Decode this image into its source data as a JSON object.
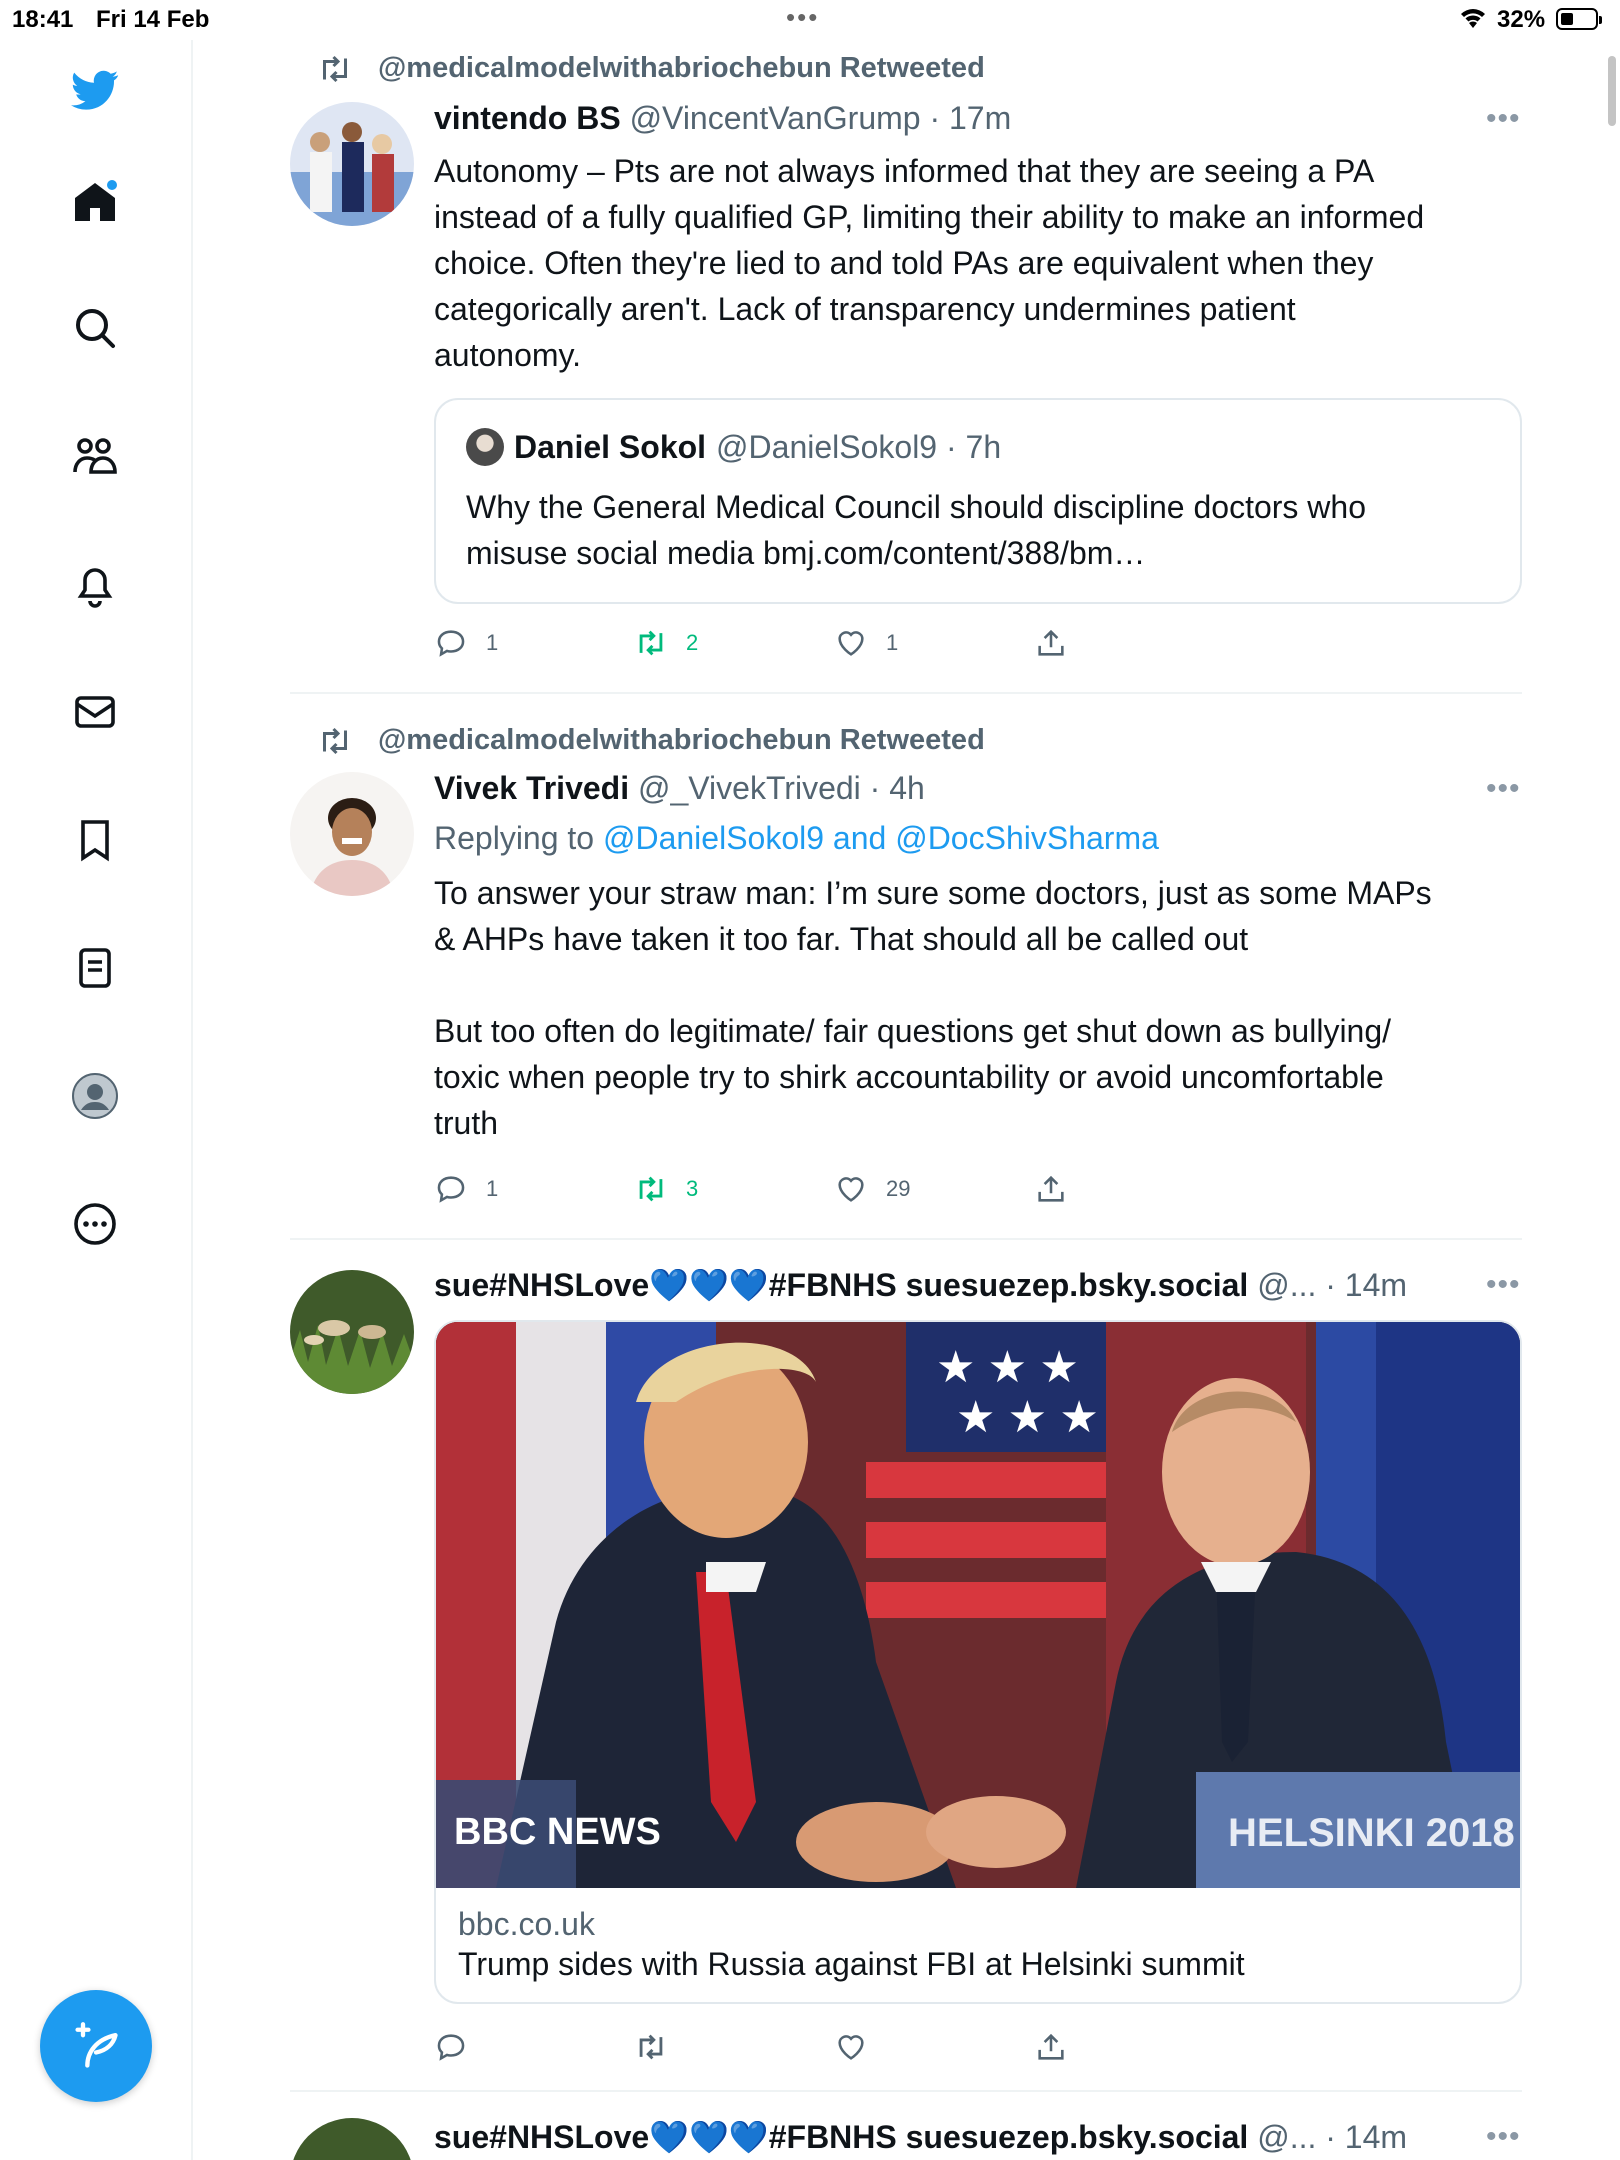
{
  "status_bar": {
    "time": "18:41",
    "date": "Fri 14 Feb",
    "battery": "32%"
  },
  "sidebar": {
    "items": [
      {
        "name": "logo"
      },
      {
        "name": "home"
      },
      {
        "name": "explore"
      },
      {
        "name": "communities"
      },
      {
        "name": "notifications"
      },
      {
        "name": "messages"
      },
      {
        "name": "bookmarks"
      },
      {
        "name": "lists"
      },
      {
        "name": "profile"
      },
      {
        "name": "more"
      }
    ],
    "compose_icon": "compose-icon"
  },
  "feed": {
    "tweets": [
      {
        "retweeted_by": "@medicalmodelwithabriochebun Retweeted",
        "name": "vintendo BS",
        "handle_time": "@VincentVanGrump · 17m",
        "text": "Autonomy – Pts are not always informed that they are seeing a PA\ninstead of a fully qualified GP, limiting their ability to make an informed\nchoice. Often they're lied to and told PAs are equivalent when they\ncategorically aren't. Lack of transparency undermines patient\nautonomy.",
        "quote": {
          "name": "Daniel Sokol",
          "handle_time": "@DanielSokol9 · 7h",
          "text": "Why the General Medical Council should discipline doctors who\nmisuse social media bmj.com/content/388/bm…"
        },
        "replies": "1",
        "retweets": "2",
        "likes": "1"
      },
      {
        "retweeted_by": "@medicalmodelwithabriochebun Retweeted",
        "name": "Vivek Trivedi",
        "handle_time": "@_VivekTrivedi · 4h",
        "replying_prefix": "Replying to ",
        "replying_to": "@DanielSokol9 and @DocShivSharma",
        "text": "To answer your straw man: I’m sure some doctors, just as some MAPs\n& AHPs have taken it too far. That should all be called out\n\nBut too often do legitimate/ fair questions get shut down as bullying/\ntoxic when people try to shirk accountability or avoid uncomfortable\ntruth",
        "replies": "1",
        "retweets": "3",
        "likes": "29"
      },
      {
        "name": "sue#NHSLove💙💙💙#FBNHS suesuezep.bsky.social",
        "handle_time": "@... · 14m",
        "card": {
          "domain": "bbc.co.uk",
          "title": "Trump sides with Russia against FBI at Helsinki summit",
          "image_overlay_left": "BBC NEWS",
          "image_overlay_right": "HELSINKI 2018"
        }
      },
      {
        "name": "sue#NHSLove💙💙💙#FBNHS suesuezep.bsky.social",
        "handle_time": "@... · 14m"
      }
    ]
  }
}
